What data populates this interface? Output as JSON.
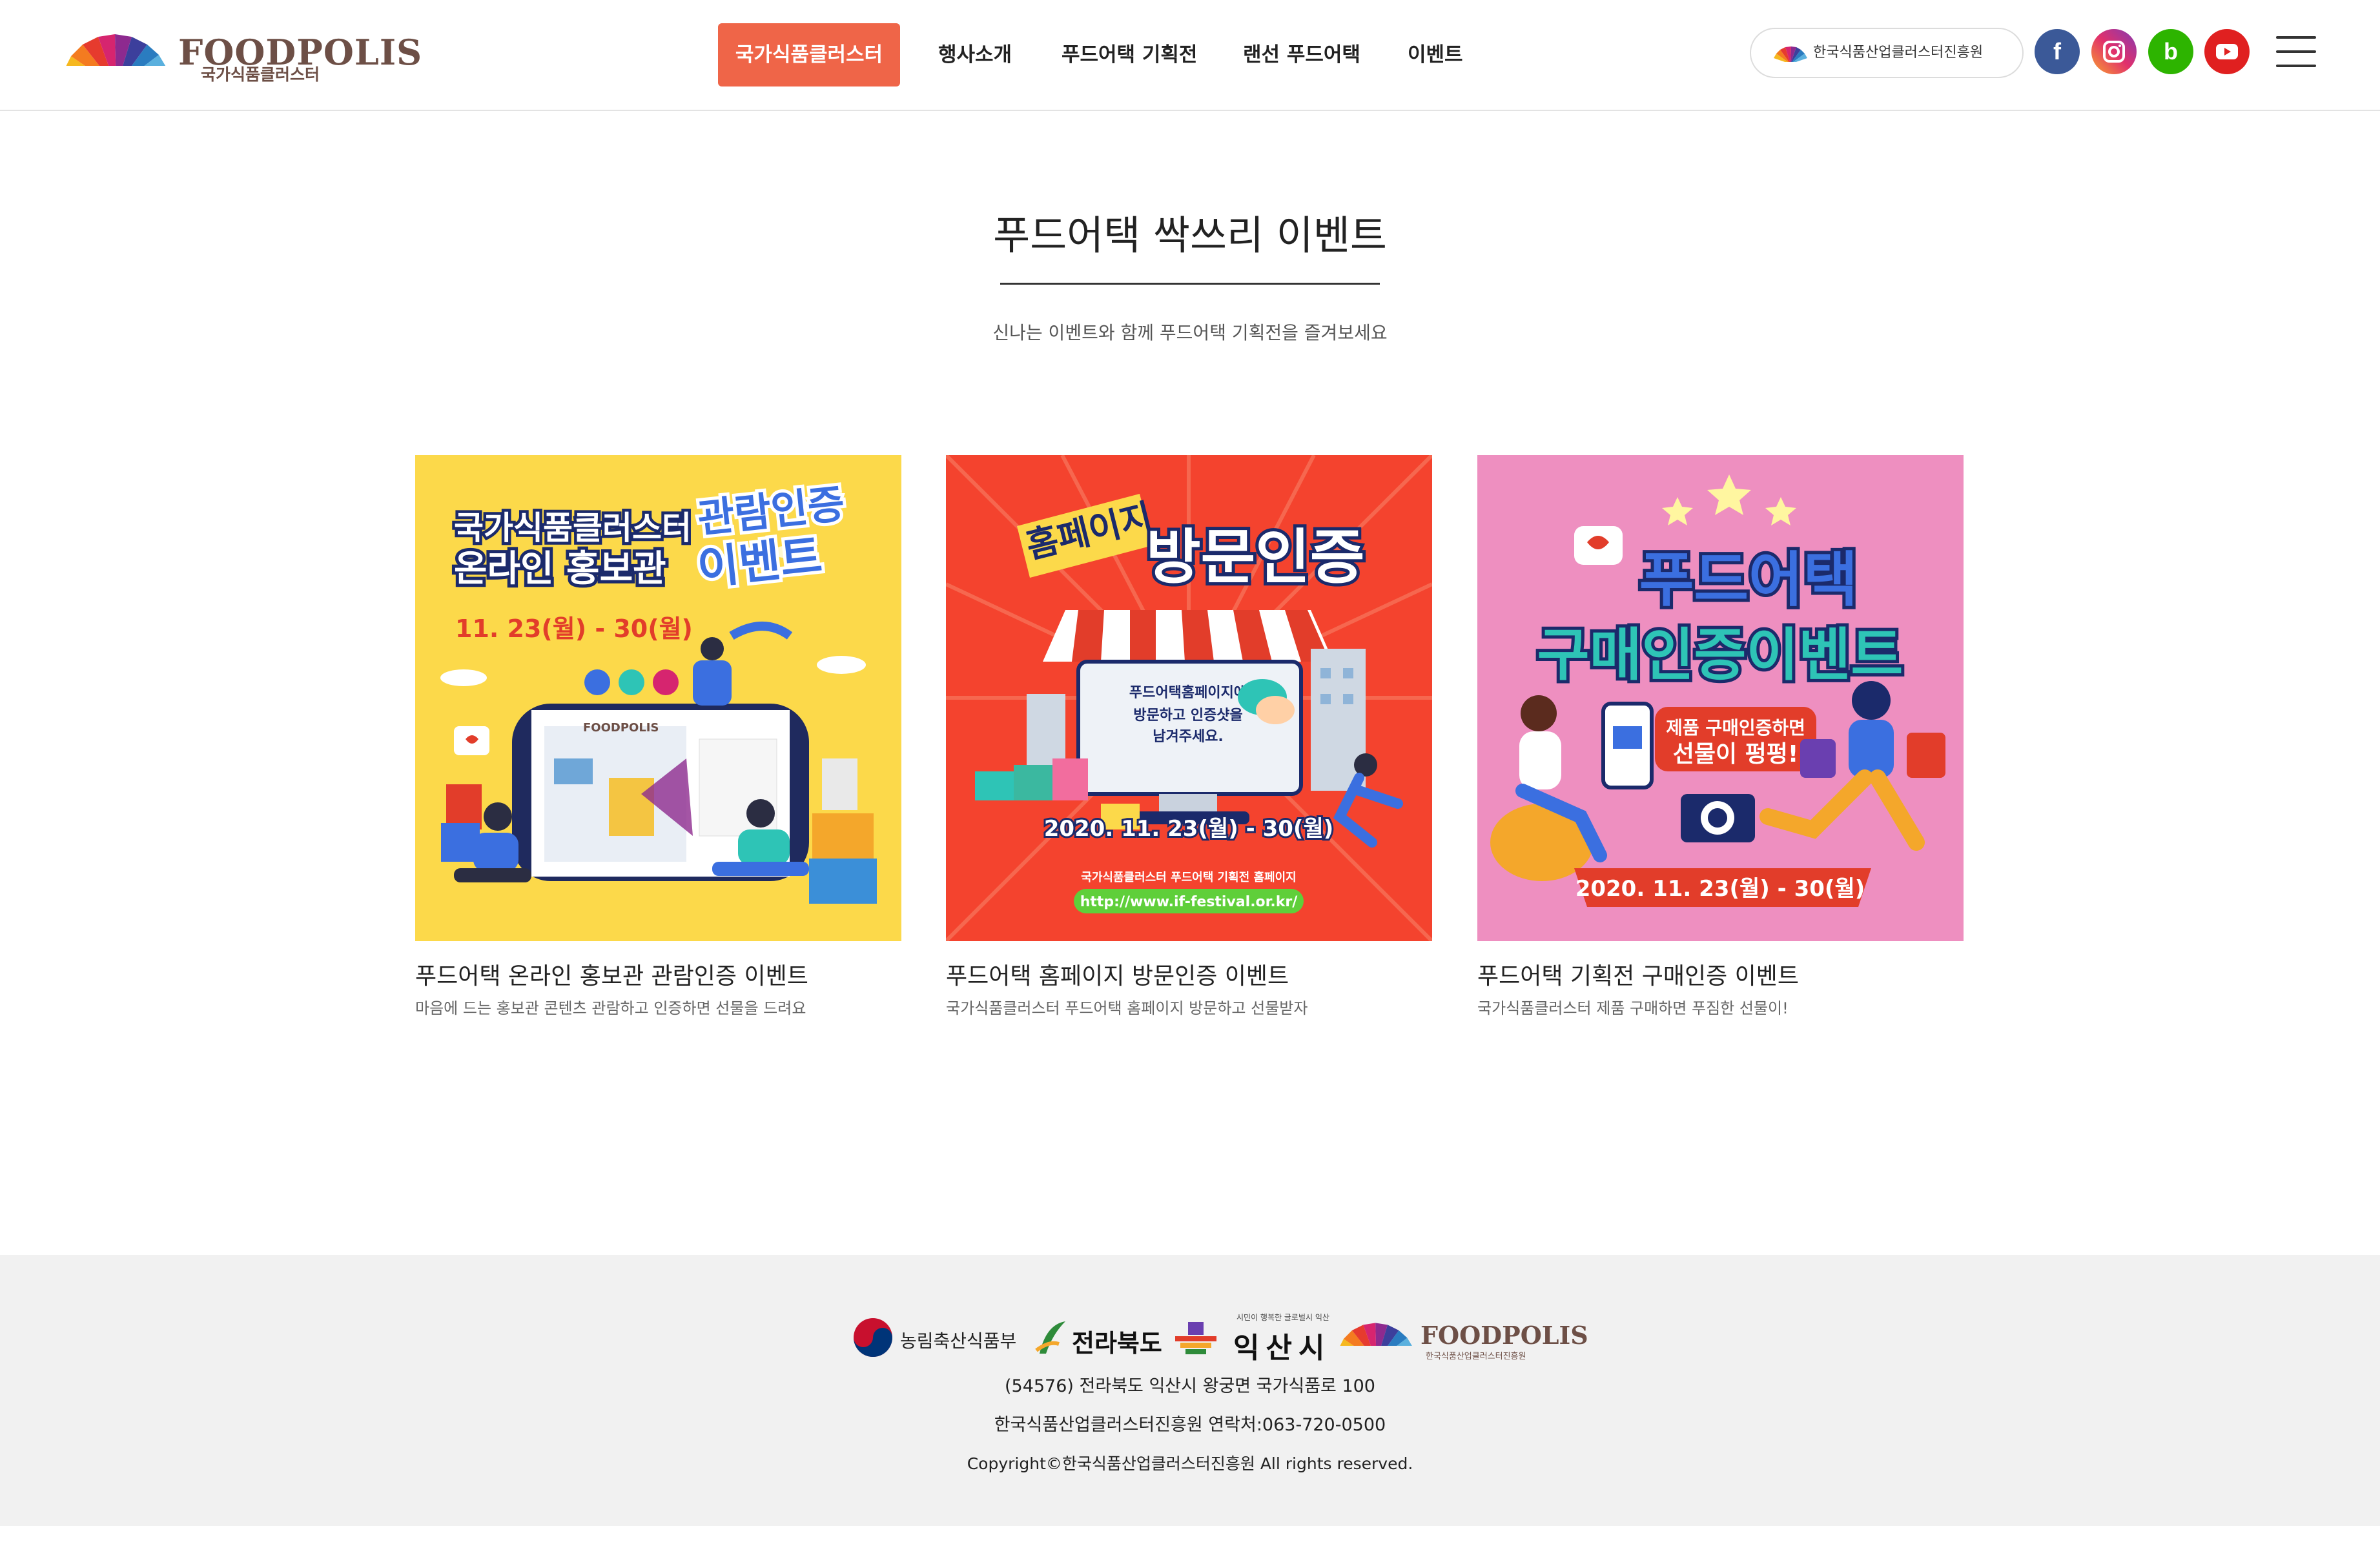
{
  "header": {
    "logo": {
      "wordmark": "FOODPOLIS",
      "subtitle": "국가식품클러스터"
    },
    "nav": [
      {
        "label": "국가식품클러스터",
        "active": true
      },
      {
        "label": "행사소개",
        "active": false
      },
      {
        "label": "푸드어택 기획전",
        "active": false
      },
      {
        "label": "랜선 푸드어택",
        "active": false
      },
      {
        "label": "이벤트",
        "active": false
      }
    ],
    "org_link": "한국식품산업클러스터진흥원",
    "social": [
      {
        "icon": "facebook-icon",
        "glyph": "f",
        "color": "#3b5998"
      },
      {
        "icon": "instagram-icon",
        "glyph": "◎",
        "color": "#c13584"
      },
      {
        "icon": "blog-icon",
        "glyph": "b",
        "color": "#2db400"
      },
      {
        "icon": "youtube-icon",
        "glyph": "▶",
        "color": "#e02020"
      }
    ],
    "accent_color": "#ef6548"
  },
  "main": {
    "title": "푸드어택 싹쓰리 이벤트",
    "subtitle": "신나는 이벤트와 함께 푸드어택 기획전을 즐겨보세요",
    "cards": [
      {
        "title": "푸드어택 온라인 홍보관 관람인증 이벤트",
        "desc": "마음에 드는 홍보관 콘텐츠 관람하고 인증하면 선물을 드려요",
        "poster": {
          "line1": "국가식품클러스터",
          "line2": "온라인 홍보관",
          "line3": "관람인증",
          "line4": "이벤트",
          "date": "11. 23(월) - 30(월)",
          "screen_logo": "FOODPOLIS",
          "bg": "#fcd94a"
        }
      },
      {
        "title": "푸드어택 홈페이지 방문인증 이벤트",
        "desc": "국가식품클러스터 푸드어택 홈페이지 방문하고 선물받자",
        "poster": {
          "flag": "홈페이지",
          "headline": "방문인증",
          "screen_line1": "푸드어택홈페이지에",
          "screen_line2": "방문하고 인증샷을",
          "screen_line3": "남겨주세요.",
          "date": "2020. 11. 23(월) - 30(월)",
          "caption": "국가식품클러스터 푸드어택 기획전 홈페이지",
          "url": "http://www.if-festival.or.kr/",
          "bg": "#f4432e"
        }
      },
      {
        "title": "푸드어택 기획전 구매인증 이벤트",
        "desc": "국가식품클러스터 제품 구매하면 푸짐한 선물이!",
        "poster": {
          "line1": "푸드어택",
          "line2": "구매인증이벤트",
          "bubble1": "제품 구매인증하면",
          "bubble2": "선물이 펑펑!",
          "date": "2020. 11. 23(월) - 30(월)",
          "bg": "#ee8fc0"
        }
      }
    ]
  },
  "footer": {
    "partners": {
      "ministry": "농림축산식품부",
      "province": "전라북도",
      "city_tagline": "시민이 행복한 글로벌시 익산",
      "city": "익산시",
      "foodpolis": "FOODPOLIS",
      "foodpolis_sub": "한국식품산업클러스터진흥원"
    },
    "address": "(54576) 전라북도 익산시 왕궁면 국가식품로 100",
    "contact": "한국식품산업클러스터진흥원 연락처:063-720-0500",
    "copyright": "Copyright©한국식품산업클러스터진흥원 All rights reserved."
  }
}
